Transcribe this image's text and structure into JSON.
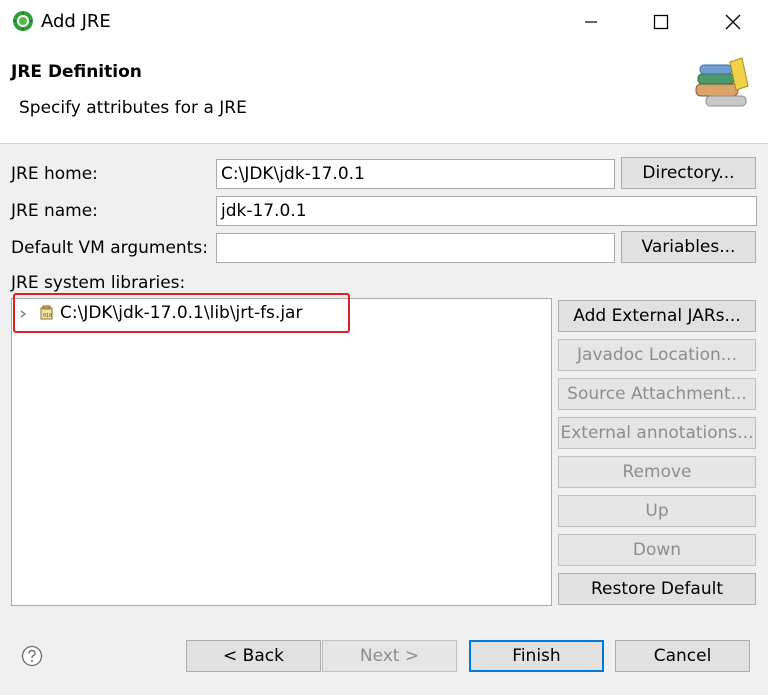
{
  "window": {
    "title": "Add JRE",
    "icon": "eclipse-icon",
    "controls": [
      "minimize-icon",
      "maximize-icon",
      "close-icon"
    ]
  },
  "header": {
    "title": "JRE Definition",
    "description": "Specify attributes for a JRE",
    "icon": "library-books-icon"
  },
  "form": {
    "jre_home_label": "JRE home:",
    "jre_home_value": "C:\\JDK\\jdk-17.0.1",
    "directory_button": "Directory...",
    "jre_name_label": "JRE name:",
    "jre_name_value": "jdk-17.0.1",
    "vm_args_label": "Default VM arguments:",
    "vm_args_value": "",
    "variables_button": "Variables...",
    "libraries_label": "JRE system libraries:"
  },
  "libraries": {
    "items": [
      {
        "label": "C:\\JDK\\jdk-17.0.1\\lib\\jrt-fs.jar",
        "icon": "jar-icon",
        "expand_icon": "chevron-right-icon"
      }
    ],
    "highlight_color": "#e02020"
  },
  "library_buttons": {
    "add_external_jars": "Add External JARs...",
    "javadoc_location": "Javadoc Location...",
    "source_attachment": "Source Attachment...",
    "external_annotations": "External annotations...",
    "remove": "Remove",
    "up": "Up",
    "down": "Down",
    "restore_default": "Restore Default"
  },
  "footer": {
    "help_icon": "help-icon",
    "back": "< Back",
    "next": "Next >",
    "finish": "Finish",
    "cancel": "Cancel",
    "accent_color": "#0078d7"
  }
}
